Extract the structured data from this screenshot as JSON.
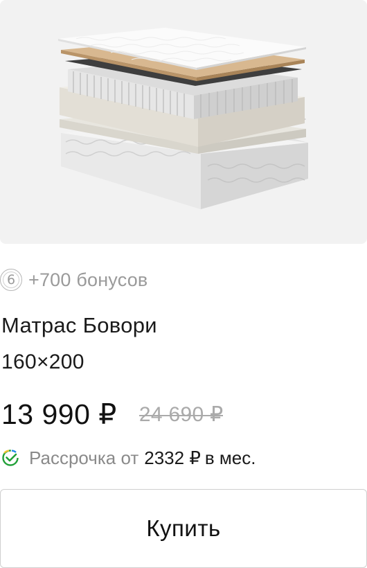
{
  "product": {
    "image_alt": "mattress-layers",
    "bonus_badge": "6",
    "bonus_text": "+700 бонусов",
    "title": "Матрас Бовори",
    "size": "160×200",
    "price": "13 990 ₽",
    "old_price": "24 690 ₽",
    "installment_label": "Рассрочка от",
    "installment_amount": "2332 ₽",
    "installment_suffix": "в мес.",
    "buy_label": "Купить"
  },
  "colors": {
    "image_bg": "#f2f2f2",
    "muted_text": "#9a9a9a",
    "sber_green": "#21a038",
    "sber_yellow": "#f2c531",
    "sber_blue": "#1e88e5"
  }
}
